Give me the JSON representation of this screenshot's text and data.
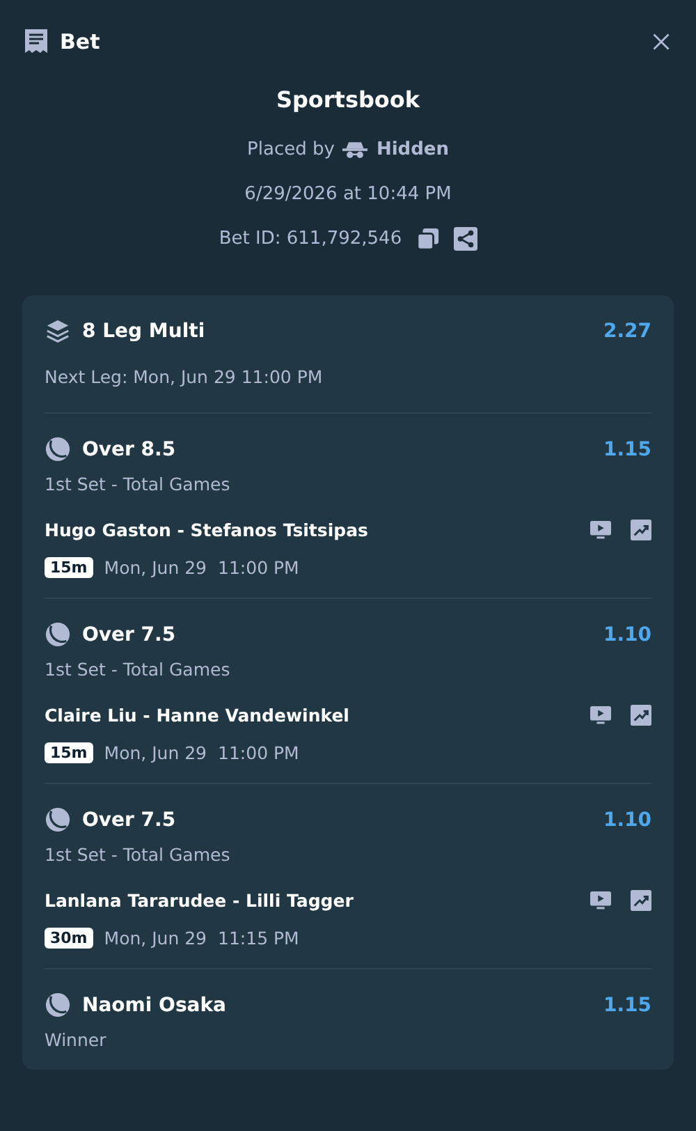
{
  "header": {
    "title": "Bet"
  },
  "summary": {
    "source": "Sportsbook",
    "placed_by_label": "Placed by",
    "placed_by_user": "Hidden",
    "placed_at": "6/29/2026 at 10:44 PM",
    "bet_id": "Bet ID: 611,792,546"
  },
  "multi": {
    "title": "8 Leg Multi",
    "odds": "2.27",
    "next_leg": "Next Leg: Mon, Jun 29 11:00 PM"
  },
  "legs": [
    {
      "selection": "Over 8.5",
      "odds": "1.15",
      "market": "1st Set - Total Games",
      "match": "Hugo Gaston - Stefanos Tsitsipas",
      "badge": "15m",
      "date": "Mon, Jun 29",
      "time": "11:00 PM"
    },
    {
      "selection": "Over 7.5",
      "odds": "1.10",
      "market": "1st Set - Total Games",
      "match": "Claire Liu - Hanne Vandewinkel",
      "badge": "15m",
      "date": "Mon, Jun 29",
      "time": "11:00 PM"
    },
    {
      "selection": "Over 7.5",
      "odds": "1.10",
      "market": "1st Set - Total Games",
      "match": "Lanlana Tararudee - Lilli Tagger",
      "badge": "30m",
      "date": "Mon, Jun 29",
      "time": "11:15 PM"
    },
    {
      "selection": "Naomi Osaka",
      "odds": "1.15",
      "market": "Winner"
    }
  ]
}
